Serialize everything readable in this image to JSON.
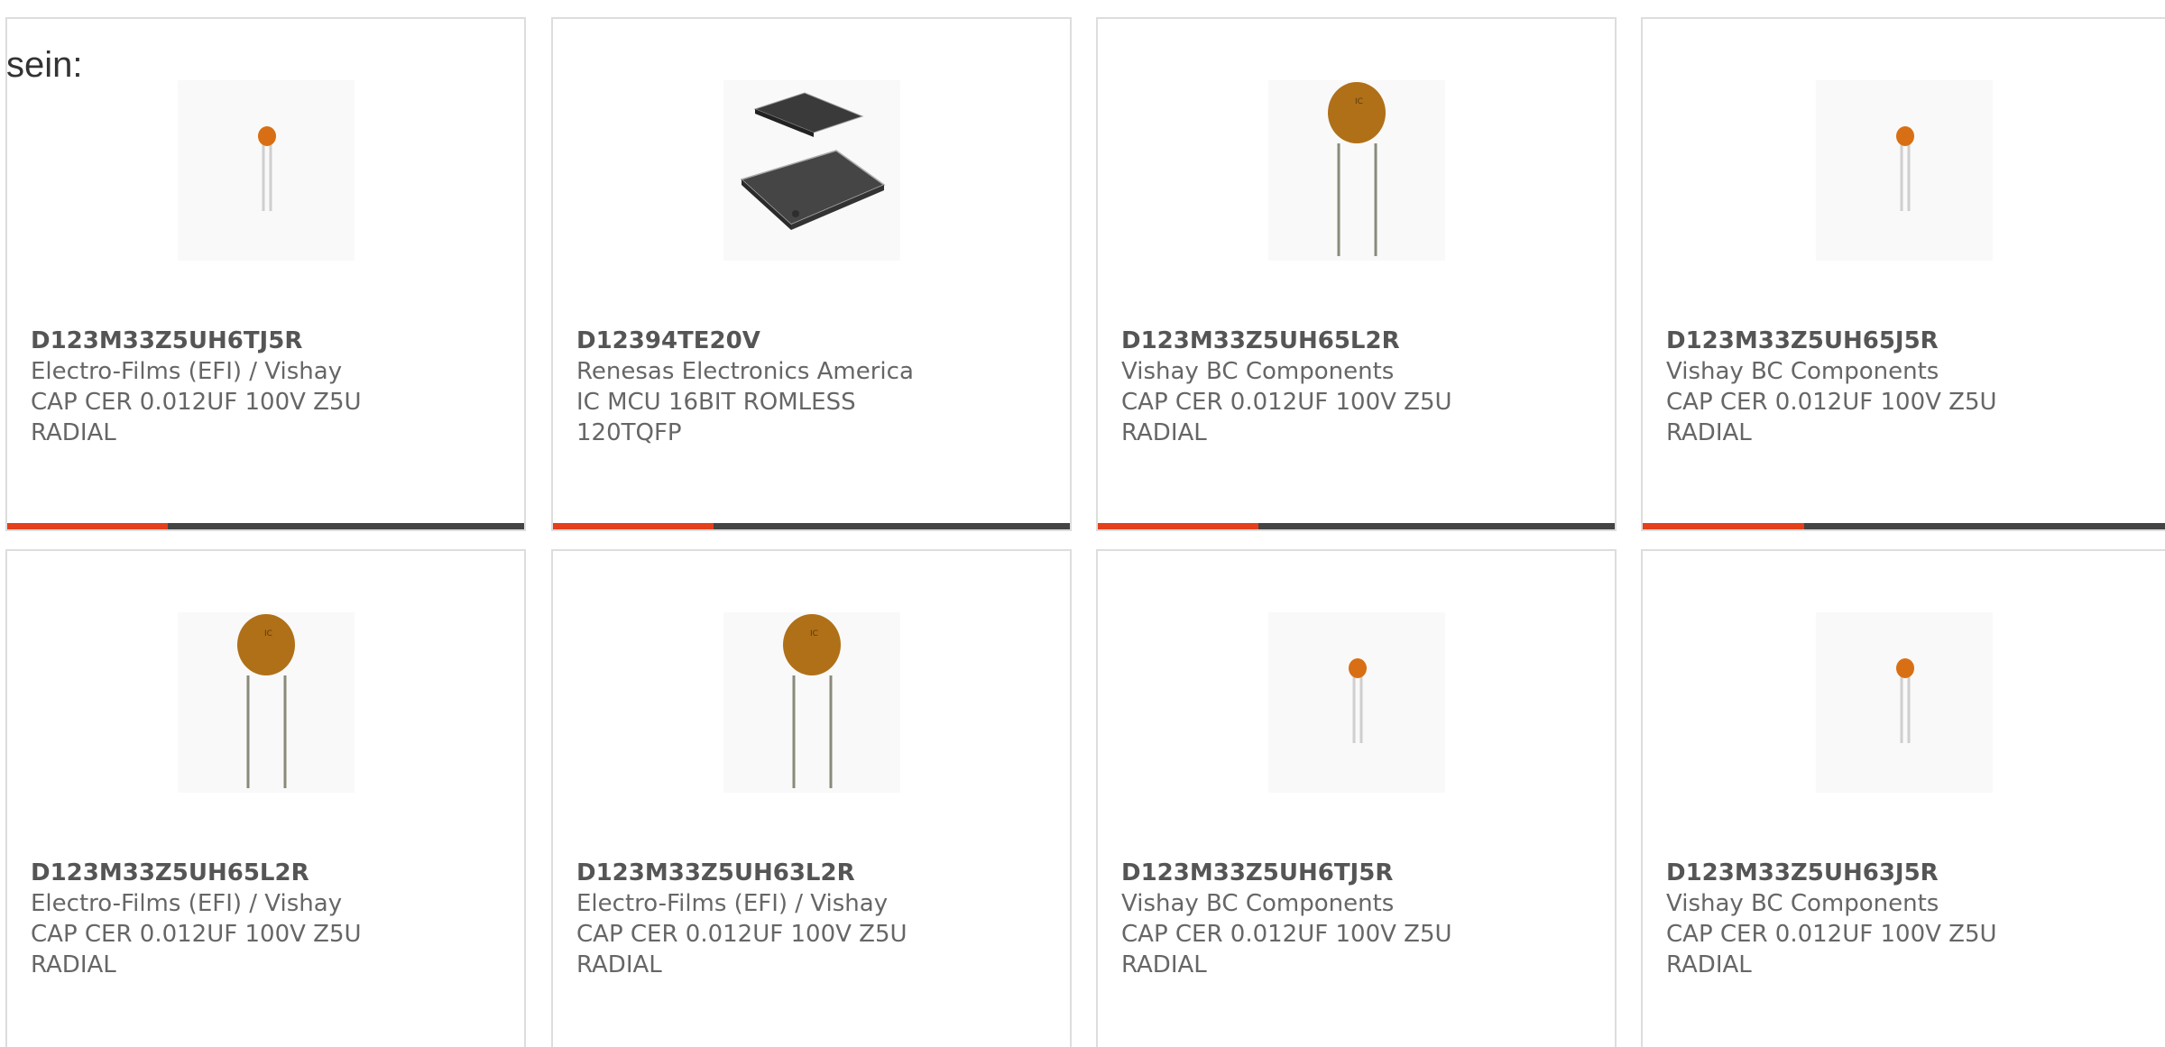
{
  "intro_text": "sein:",
  "colors": {
    "accent": "#e4401b",
    "bar_track": "#444444",
    "text": "#666666",
    "border": "#dddddd"
  },
  "products": [
    {
      "part_number": "D123M33Z5UH6TJ5R",
      "manufacturer": "Electro-Films (EFI) / Vishay",
      "description": "CAP CER 0.012UF 100V Z5U RADIAL",
      "image_icon": "small-ceramic-capacitor-icon",
      "progress": 0.31
    },
    {
      "part_number": "D12394TE20V",
      "manufacturer": "Renesas Electronics America",
      "description": "IC MCU 16BIT ROMLESS 120TQFP",
      "image_icon": "tqfp-chip-icon",
      "progress": 0.31
    },
    {
      "part_number": "D123M33Z5UH65L2R",
      "manufacturer": "Vishay BC Components",
      "description": "CAP CER 0.012UF 100V Z5U RADIAL",
      "image_icon": "large-disc-capacitor-icon",
      "progress": 0.31
    },
    {
      "part_number": "D123M33Z5UH65J5R",
      "manufacturer": "Vishay BC Components",
      "description": "CAP CER 0.012UF 100V Z5U RADIAL",
      "image_icon": "small-ceramic-capacitor-icon",
      "progress": 0.31
    },
    {
      "part_number": "D123M33Z5UH65L2R",
      "manufacturer": "Electro-Films (EFI) / Vishay",
      "description": "CAP CER 0.012UF 100V Z5U RADIAL",
      "image_icon": "large-disc-capacitor-icon"
    },
    {
      "part_number": "D123M33Z5UH63L2R",
      "manufacturer": "Electro-Films (EFI) / Vishay",
      "description": "CAP CER 0.012UF 100V Z5U RADIAL",
      "image_icon": "large-disc-capacitor-icon"
    },
    {
      "part_number": "D123M33Z5UH6TJ5R",
      "manufacturer": "Vishay BC Components",
      "description": "CAP CER 0.012UF 100V Z5U RADIAL",
      "image_icon": "small-ceramic-capacitor-icon"
    },
    {
      "part_number": "D123M33Z5UH63J5R",
      "manufacturer": "Vishay BC Components",
      "description": "CAP CER 0.012UF 100V Z5U RADIAL",
      "image_icon": "small-ceramic-capacitor-icon"
    }
  ]
}
